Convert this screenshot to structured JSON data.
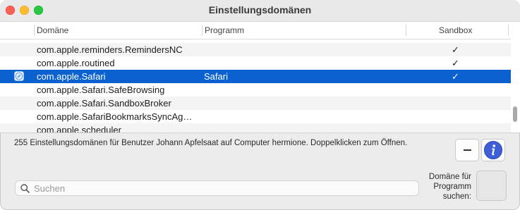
{
  "window": {
    "title": "Einstellungsdomänen"
  },
  "table": {
    "columns": {
      "domain": "Domäne",
      "program": "Programm",
      "sandbox": "Sandbox"
    },
    "rows": [
      {
        "domain": "com.apple.reminders.RemindersNC",
        "program": "",
        "sandbox": "✓"
      },
      {
        "domain": "com.apple.routined",
        "program": "",
        "sandbox": "✓"
      },
      {
        "domain": "com.apple.Safari",
        "program": "Safari",
        "sandbox": "✓"
      },
      {
        "domain": "com.apple.Safari.SafeBrowsing",
        "program": "",
        "sandbox": ""
      },
      {
        "domain": "com.apple.Safari.SandboxBroker",
        "program": "",
        "sandbox": ""
      },
      {
        "domain": "com.apple.SafariBookmarksSyncAg…",
        "program": "",
        "sandbox": ""
      },
      {
        "domain": "com.apple.scheduler",
        "program": "",
        "sandbox": ""
      }
    ],
    "selected_row": "com.apple.Safari"
  },
  "status": {
    "text": "255 Einstellungsdomänen für Benutzer Johann Apfelsaat auf Computer hermione. Doppelklicken zum Öffnen."
  },
  "search": {
    "placeholder": "Suchen",
    "value": ""
  },
  "lookup": {
    "label": "Domäne für Programm suchen:"
  },
  "icons": {
    "minus": "minus-icon",
    "info": "info-icon",
    "search": "search-icon",
    "compass": "safari-compass-icon"
  },
  "colors": {
    "selection": "#0a61cf",
    "info_button": "#3f5fd6"
  }
}
